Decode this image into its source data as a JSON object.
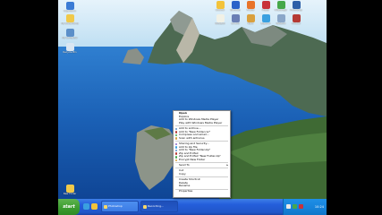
{
  "desktop": {
    "left_icons": [
      {
        "label": "Inspiration"
      },
      {
        "label": "My Documents"
      },
      {
        "label": "My Computer"
      },
      {
        "label": "Recycle Bin"
      },
      {
        "label": "New Folder"
      }
    ],
    "right_icons": [
      {
        "label": "Outlook"
      },
      {
        "label": "Windows"
      },
      {
        "label": "Firefox"
      },
      {
        "label": "Player"
      },
      {
        "label": "Messenger"
      },
      {
        "label": "Photoshop"
      },
      {
        "label": "Notepad"
      },
      {
        "label": "Control"
      },
      {
        "label": "Paint"
      },
      {
        "label": "Explorer"
      },
      {
        "label": "Network"
      },
      {
        "label": "Firewall"
      }
    ]
  },
  "context_menu": {
    "items": [
      {
        "label": "Open",
        "default": true
      },
      {
        "label": "Explore"
      },
      {
        "label": "Add to Windows Media Player"
      },
      {
        "label": "Play with Windows Media Player"
      },
      {
        "sep": true
      },
      {
        "label": "Add to archive..."
      },
      {
        "label": "Add to \"New Folder.rar\""
      },
      {
        "label": "Compress and email..."
      },
      {
        "label": "Scan with antivirus"
      },
      {
        "sep": true
      },
      {
        "label": "Sharing and Security..."
      },
      {
        "label": "Add to zip file"
      },
      {
        "label": "Add to \"New Folder.zip\""
      },
      {
        "label": "Zip and E-Mail"
      },
      {
        "label": "Zip and E-Mail \"New Folder.zip\""
      },
      {
        "label": "Encrypt New Folder"
      },
      {
        "sep": true
      },
      {
        "label": "Send To",
        "submenu": true
      },
      {
        "sep": true
      },
      {
        "label": "Cut"
      },
      {
        "label": "Copy"
      },
      {
        "sep": true
      },
      {
        "label": "Create Shortcut"
      },
      {
        "label": "Delete"
      },
      {
        "label": "Rename"
      },
      {
        "sep": true
      },
      {
        "label": "Properties"
      }
    ]
  },
  "taskbar": {
    "start_label": "start",
    "tasks": [
      {
        "label": "Photoshop"
      },
      {
        "label": "Recording..."
      }
    ],
    "clock": "10:24"
  },
  "colors": {
    "sky": "#cfe7f7",
    "sea": "#1a5fb4",
    "taskbar": "#245edb",
    "start": "#3a9b2e",
    "tray": "#1784dc"
  }
}
